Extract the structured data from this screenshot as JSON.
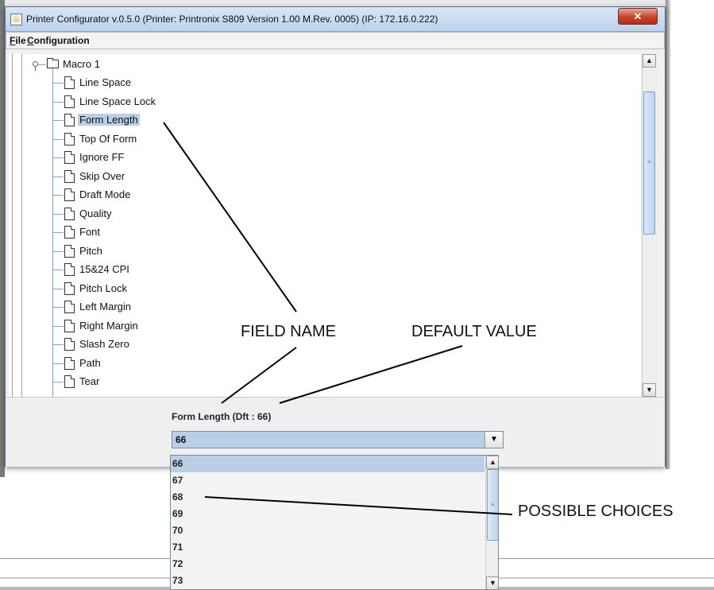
{
  "window": {
    "title": "Printer Configurator v.0.5.0 (Printer: Printronix S809 Version  1.00 M.Rev. 0005)  (IP: 172.16.0.222)",
    "close_label": "✕"
  },
  "menu": {
    "file": {
      "mnemonic": "F",
      "rest": "ile"
    },
    "configuration": {
      "mnemonic": "C",
      "rest": "onfiguration"
    }
  },
  "tree": {
    "parent_label": "Macro 1",
    "items": [
      "Line Space",
      "Line Space Lock",
      "Form Length",
      "Top Of Form",
      "Ignore FF",
      "Skip Over",
      "Draft Mode",
      "Quality",
      "Font",
      "Pitch",
      "15&24 CPI",
      "Pitch Lock",
      "Left Margin",
      "Right Margin",
      "Slash Zero",
      "Path",
      "Tear"
    ],
    "selected_item": "Form Length"
  },
  "field": {
    "label": "Form Length (Dft : 66)",
    "selected_value": "66"
  },
  "dropdown": {
    "options": [
      "66",
      "67",
      "68",
      "69",
      "70",
      "71",
      "72",
      "73"
    ],
    "selected": "66"
  },
  "annotations": {
    "field_name": "FIELD NAME",
    "default_value": "DEFAULT VALUE",
    "possible_choices": "POSSIBLE CHOICES"
  },
  "icons": {
    "up_arrow": "▲",
    "down_arrow": "▼",
    "grip": "≡"
  }
}
